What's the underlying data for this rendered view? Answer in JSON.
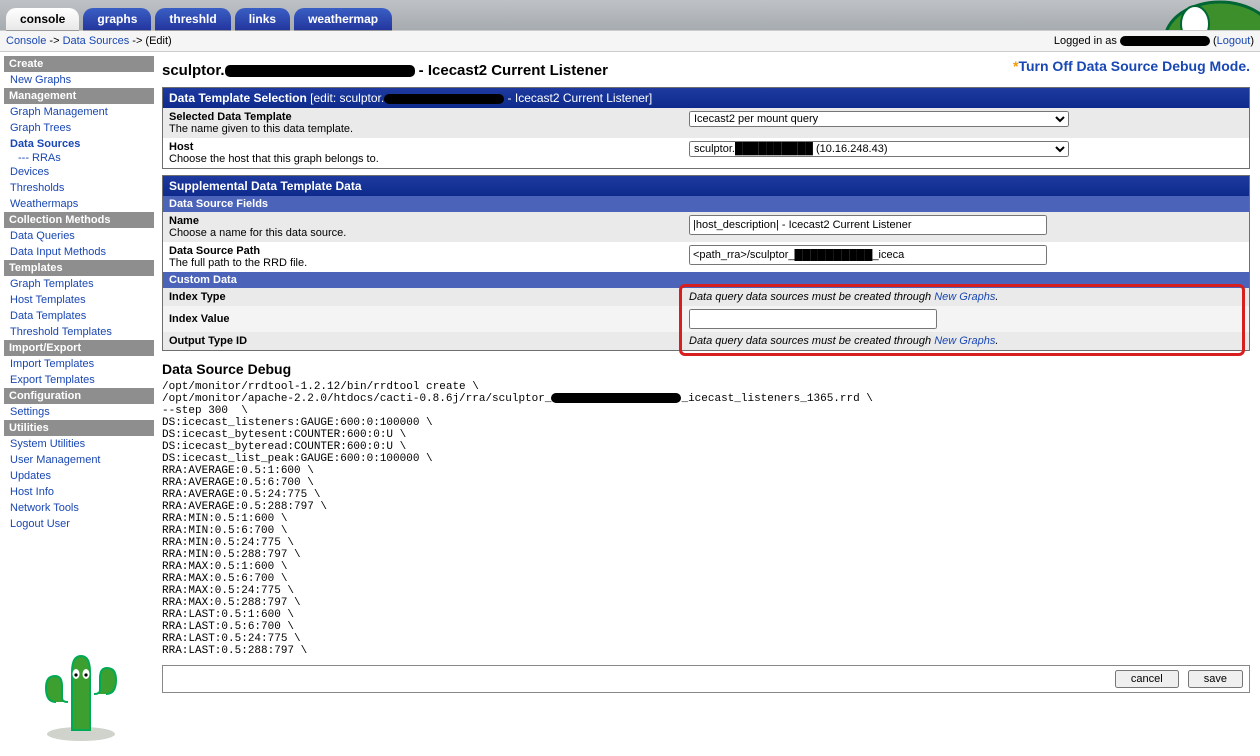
{
  "tabs": [
    "console",
    "graphs",
    "threshld",
    "links",
    "weathermap"
  ],
  "tab_selected": 0,
  "breadcrumbs": {
    "c": "Console",
    "ds": "Data Sources",
    "edit": "(Edit)"
  },
  "login": {
    "prefix": "Logged in as",
    "logout": "Logout"
  },
  "sidebar": [
    {
      "sec": "Create",
      "items": [
        {
          "t": "New Graphs"
        }
      ]
    },
    {
      "sec": "Management",
      "items": [
        {
          "t": "Graph Management"
        },
        {
          "t": "Graph Trees"
        },
        {
          "t": "Data Sources",
          "sel": true,
          "sub": "--- RRAs"
        },
        {
          "t": "Devices"
        },
        {
          "t": "Thresholds"
        },
        {
          "t": "Weathermaps"
        }
      ]
    },
    {
      "sec": "Collection Methods",
      "items": [
        {
          "t": "Data Queries"
        },
        {
          "t": "Data Input Methods"
        }
      ]
    },
    {
      "sec": "Templates",
      "items": [
        {
          "t": "Graph Templates"
        },
        {
          "t": "Host Templates"
        },
        {
          "t": "Data Templates"
        },
        {
          "t": "Threshold Templates"
        }
      ]
    },
    {
      "sec": "Import/Export",
      "items": [
        {
          "t": "Import Templates"
        },
        {
          "t": "Export Templates"
        }
      ]
    },
    {
      "sec": "Configuration",
      "items": [
        {
          "t": "Settings"
        }
      ]
    },
    {
      "sec": "Utilities",
      "items": [
        {
          "t": "System Utilities"
        },
        {
          "t": "User Management"
        },
        {
          "t": "Updates"
        },
        {
          "t": "Host Info"
        },
        {
          "t": "Network Tools"
        },
        {
          "t": "Logout User"
        }
      ]
    }
  ],
  "page_title_prefix": "sculptor.",
  "page_title_suffix": " - Icecast2 Current Listener",
  "debug_banner": "Turn Off Data Source Debug Mode.",
  "panel1": {
    "hd": "Data Template Selection",
    "hd_suffix_pre": " [edit: sculptor.",
    "hd_suffix_post": " - Icecast2 Current Listener]",
    "row1": {
      "t": "Selected Data Template",
      "d": "The name given to this data template.",
      "v": "Icecast2 per mount query"
    },
    "row2": {
      "t": "Host",
      "d": "Choose the host that this graph belongs to.",
      "v_pre": "sculptor.",
      "v_post": " (10.16.248.43)"
    }
  },
  "panel2": {
    "hd": "Supplemental Data Template Data",
    "sub1": "Data Source Fields",
    "name": {
      "t": "Name",
      "d": "Choose a name for this data source.",
      "v": "|host_description| - Icecast2 Current Listener"
    },
    "path": {
      "t": "Data Source Path",
      "d": "The full path to the RRD file.",
      "v_pre": "<path_rra>/sculptor_",
      "v_post": "_iceca"
    },
    "sub2": "Custom Data",
    "idx_type": "Index Type",
    "idx_val": "Index Value",
    "out_id": "Output Type ID",
    "note_pre": "Data query data sources must be created through ",
    "note_link": "New Graphs",
    "note_post": "."
  },
  "debug": {
    "hd": "Data Source Debug",
    "l01": "/opt/monitor/rrdtool-1.2.12/bin/rrdtool create \\",
    "l02a": "/opt/monitor/apache-2.2.0/htdocs/cacti-0.8.6j/rra/sculptor_",
    "l02b": "_icecast_listeners_1365.rrd \\",
    "rest": "--step 300  \\\nDS:icecast_listeners:GAUGE:600:0:100000 \\\nDS:icecast_bytesent:COUNTER:600:0:U \\\nDS:icecast_byteread:COUNTER:600:0:U \\\nDS:icecast_list_peak:GAUGE:600:0:100000 \\\nRRA:AVERAGE:0.5:1:600 \\\nRRA:AVERAGE:0.5:6:700 \\\nRRA:AVERAGE:0.5:24:775 \\\nRRA:AVERAGE:0.5:288:797 \\\nRRA:MIN:0.5:1:600 \\\nRRA:MIN:0.5:6:700 \\\nRRA:MIN:0.5:24:775 \\\nRRA:MIN:0.5:288:797 \\\nRRA:MAX:0.5:1:600 \\\nRRA:MAX:0.5:6:700 \\\nRRA:MAX:0.5:24:775 \\\nRRA:MAX:0.5:288:797 \\\nRRA:LAST:0.5:1:600 \\\nRRA:LAST:0.5:6:700 \\\nRRA:LAST:0.5:24:775 \\\nRRA:LAST:0.5:288:797 \\"
  },
  "buttons": {
    "cancel": "cancel",
    "save": "save"
  }
}
